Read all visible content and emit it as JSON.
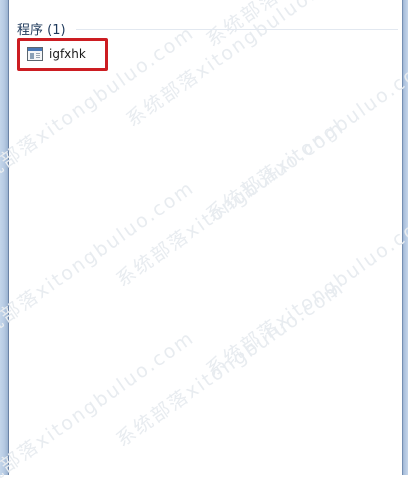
{
  "search_results": {
    "group_label": "程序 (1)",
    "items": [
      {
        "label": "igfxhk",
        "icon": "application-window-icon"
      }
    ]
  },
  "watermark": {
    "text": "系统部落xitongbuluo.com"
  },
  "colors": {
    "highlight": "#cc1d22",
    "group_header": "#1e395b"
  }
}
